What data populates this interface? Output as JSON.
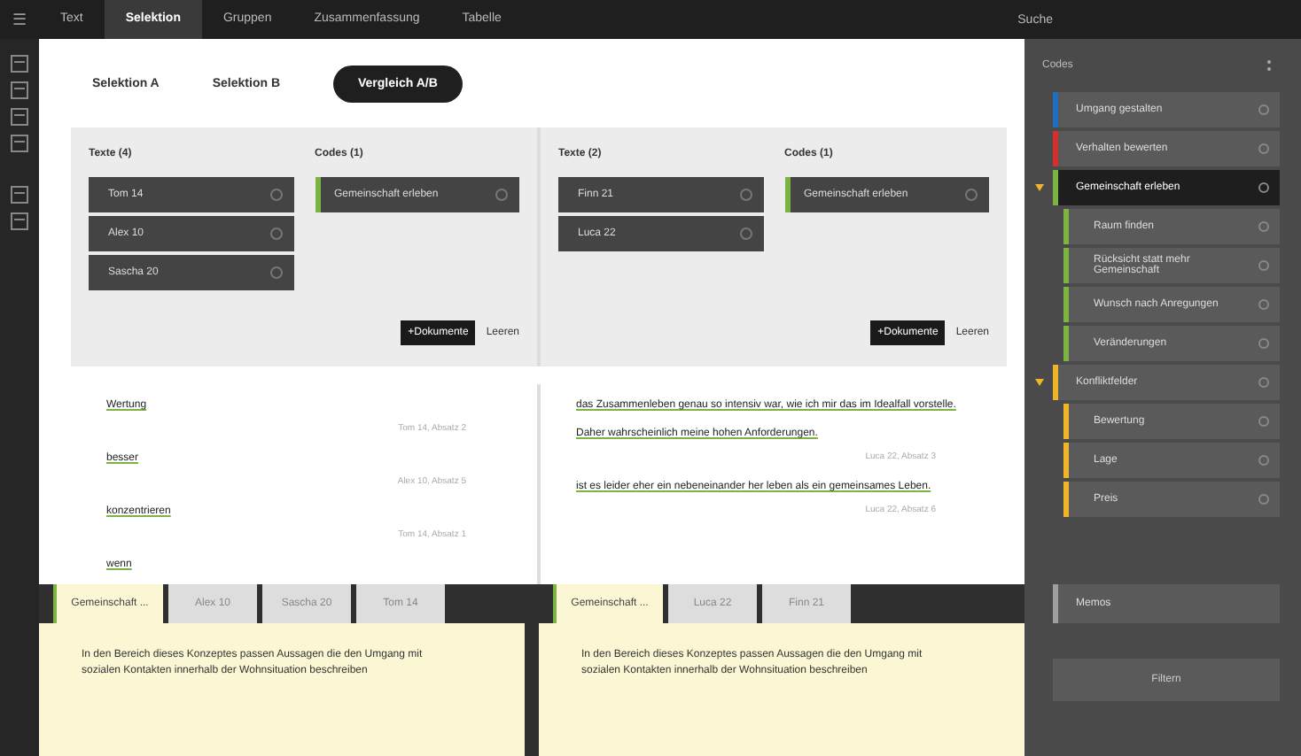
{
  "menu_icon": "☰",
  "tabs": [
    {
      "label": "Text",
      "selected": false
    },
    {
      "label": "Selektion",
      "selected": true
    },
    {
      "label": "Gruppen",
      "selected": false
    },
    {
      "label": "Zusammenfassung",
      "selected": false
    },
    {
      "label": "Tabelle",
      "selected": false
    }
  ],
  "search_label": "Suche",
  "subtabs": [
    {
      "label": "Selektion A",
      "selected": false
    },
    {
      "label": "Selektion B",
      "selected": false
    },
    {
      "label": "Vergleich A/B",
      "selected": true
    }
  ],
  "selections": [
    {
      "texts_heading": "Texte (4)",
      "texts": [
        "Tom 14",
        "Alex 10",
        "Sascha 20"
      ],
      "codes_heading": "Codes (1)",
      "codes": [
        {
          "label": "Gemeinschaft erleben",
          "color": "#7cb342"
        }
      ],
      "add_button": "+Dokumente",
      "clear_button": "Leeren",
      "results": [
        {
          "text": "Wertung",
          "source": "Tom 14, Absatz 2"
        },
        {
          "text": "besser",
          "source": "Alex 10, Absatz 5"
        },
        {
          "text": "konzentrieren",
          "source": "Tom 14, Absatz 1"
        },
        {
          "text": "wenn"
        }
      ],
      "doc_tabs": [
        {
          "label": "Gemeinschaft ...",
          "selected": true
        },
        {
          "label": "Alex 10",
          "selected": false
        },
        {
          "label": "Sascha 20",
          "selected": false
        },
        {
          "label": "Tom 14",
          "selected": false
        }
      ],
      "description": "In den Bereich dieses Konzeptes passen Aussagen die den Umgang mit sozialen Kontakten innerhalb der Wohnsituation beschreiben"
    },
    {
      "texts_heading": "Texte (2)",
      "texts": [
        "Finn 21",
        "Luca 22"
      ],
      "codes_heading": "Codes (1)",
      "codes": [
        {
          "label": "Gemeinschaft erleben",
          "color": "#7cb342"
        }
      ],
      "add_button": "+Dokumente",
      "clear_button": "Leeren",
      "results": [
        {
          "text": "das Zusammenleben genau so intensiv war, wie ich mir das im Idealfall vorstelle. Daher wahrscheinlich meine hohen Anforderungen.",
          "source": "Luca 22, Absatz 3"
        },
        {
          "text": "ist es leider eher ein nebeneinander her leben als ein gemeinsames Leben.",
          "source": "Luca 22, Absatz 6"
        }
      ],
      "doc_tabs": [
        {
          "label": "Gemeinschaft ...",
          "selected": true
        },
        {
          "label": "Luca 22",
          "selected": false
        },
        {
          "label": "Finn 21",
          "selected": false
        }
      ],
      "description": "In den Bereich dieses Konzeptes passen Aussagen die den Umgang mit sozialen Kontakten innerhalb der Wohnsituation beschreiben"
    }
  ],
  "codes_panel": {
    "title": "Codes",
    "items": [
      {
        "label": "Umgang gestalten",
        "color": "#1e6fc0",
        "selected": false,
        "expanded": false
      },
      {
        "label": "Verhalten bewerten",
        "color": "#d32f2f",
        "selected": false,
        "expanded": false
      },
      {
        "label": "Gemeinschaft erleben",
        "color": "#7cb342",
        "selected": true,
        "expanded": true,
        "children": [
          {
            "label": "Raum finden",
            "color": "#7cb342",
            "selected": false
          },
          {
            "label": "Rücksicht statt mehr Gemeinschaft",
            "color": "#7cb342",
            "selected": false
          },
          {
            "label": "Wunsch nach Anregungen",
            "color": "#7cb342",
            "selected": false
          },
          {
            "label": "Veränderungen",
            "color": "#7cb342",
            "selected": false
          }
        ]
      },
      {
        "label": "Konfliktfelder",
        "color": "#f0b429",
        "selected": false,
        "expanded": true,
        "children": [
          {
            "label": "Bewertung",
            "color": "#f0b429",
            "selected": false
          },
          {
            "label": "Lage",
            "color": "#f0b429",
            "selected": false
          },
          {
            "label": "Preis",
            "color": "#f0b429",
            "selected": false
          }
        ]
      }
    ],
    "memo": {
      "label": "Memos",
      "color": "#9e9e9e"
    },
    "filter_button": "Filtern"
  }
}
